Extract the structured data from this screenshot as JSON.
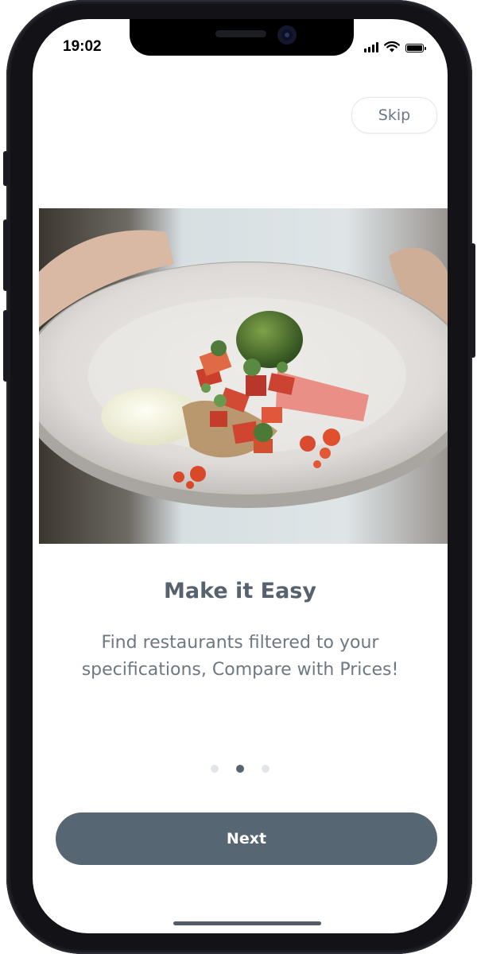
{
  "status_bar": {
    "time": "19:02",
    "icons": [
      "signal-icon",
      "wifi-icon",
      "battery-icon"
    ]
  },
  "header": {
    "skip_label": "Skip"
  },
  "hero": {
    "image_icon": "food-plate-photo"
  },
  "content": {
    "title": "Make it Easy",
    "subtitle": "Find restaurants filtered to your specifications, Compare with Prices!"
  },
  "pagination": {
    "total": 3,
    "active_index": 1
  },
  "footer": {
    "next_label": "Next"
  },
  "colors": {
    "accent": "#566672",
    "title": "#56626e",
    "subtitle": "#6d7882",
    "dot_inactive": "#e2e5e8",
    "dot_active": "#56646f"
  }
}
